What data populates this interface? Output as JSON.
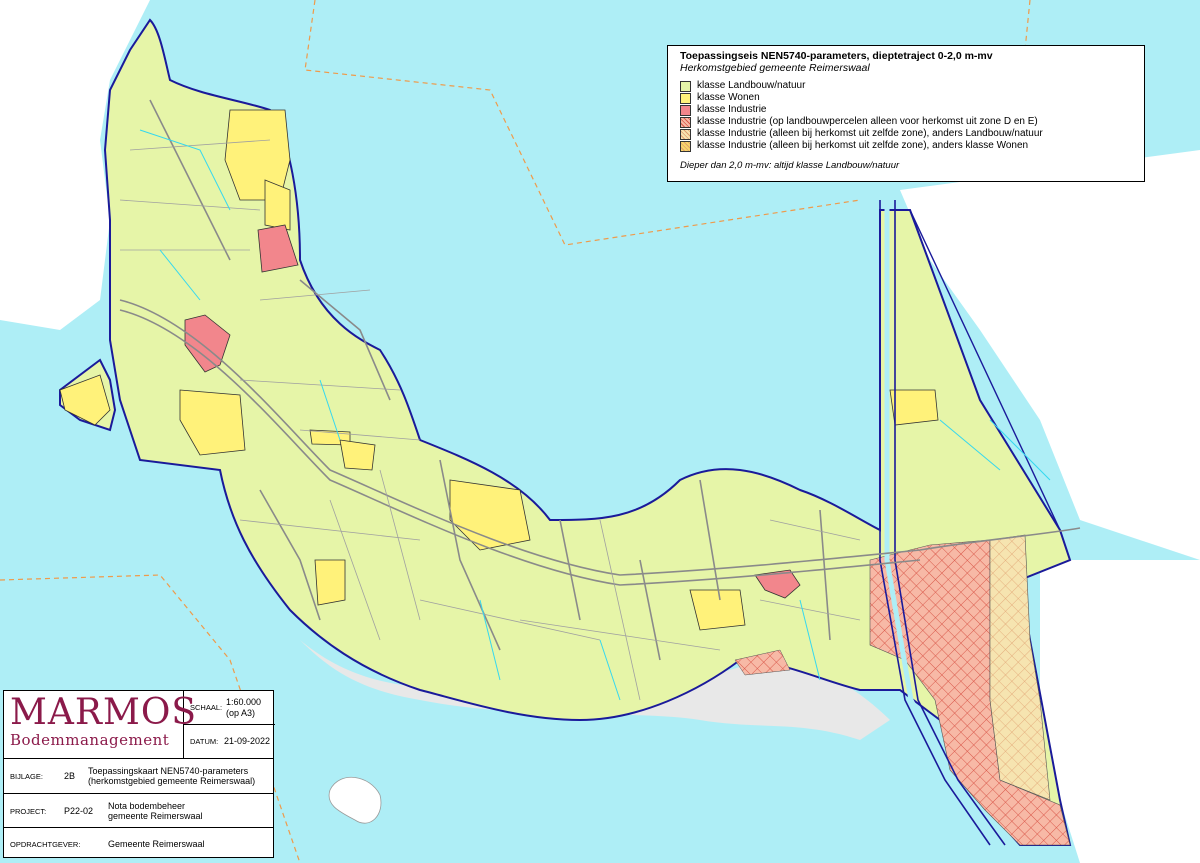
{
  "legend": {
    "title": "Toepassingseis NEN5740-parameters, dieptetraject 0-2,0 m-mv",
    "subtitle": "Herkomstgebied gemeente Reimerswaal",
    "items": [
      {
        "label": "klasse Landbouw/natuur",
        "color": "#e6f5a8"
      },
      {
        "label": "klasse Wonen",
        "color": "#fff27a"
      },
      {
        "label": "klasse Industrie",
        "color": "#f2868c"
      },
      {
        "label": "klasse Industrie (op landbouwpercelen alleen voor herkomst uit zone D en E)",
        "color": "#f2a08a"
      },
      {
        "label": "klasse Industrie (alleen bij herkomst uit zelfde zone), anders Landbouw/natuur",
        "color": "#f3dca0"
      },
      {
        "label": "klasse Industrie (alleen bij herkomst uit zelfde zone), anders klasse Wonen",
        "color": "#f8d56a"
      }
    ],
    "note": "Dieper dan 2,0 m-mv: altijd klasse Landbouw/natuur"
  },
  "title_block": {
    "logo_main": "MARMOS",
    "logo_sub": "Bodemmanagement",
    "schaal_label": "SCHAAL:",
    "schaal_value": "1:60.000",
    "schaal_note": "(op A3)",
    "datum_label": "DATUM:",
    "datum_value": "21-09-2022",
    "bijlage_label": "BIJLAGE:",
    "bijlage_code": "2B",
    "bijlage_line1": "Toepassingskaart NEN5740-parameters",
    "bijlage_line2": "(herkomstgebied gemeente Reimerswaal)",
    "project_label": "PROJECT:",
    "project_code": "P22-02",
    "project_line1": "Nota bodembeheer",
    "project_line2": "gemeente Reimerswaal",
    "opdrachtgever_label": "OPDRACHTGEVER:",
    "opdrachtgever_value": "Gemeente Reimerswaal"
  },
  "colors": {
    "water": "#aeeef6",
    "land_outside": "#e8e8e8",
    "landbouw": "#e6f5a8",
    "wonen": "#fff27a",
    "industrie": "#f2868c",
    "boundary": "#1a1a9a",
    "roads": "#8a8a8a",
    "zone_line": "#ef9a4a"
  }
}
